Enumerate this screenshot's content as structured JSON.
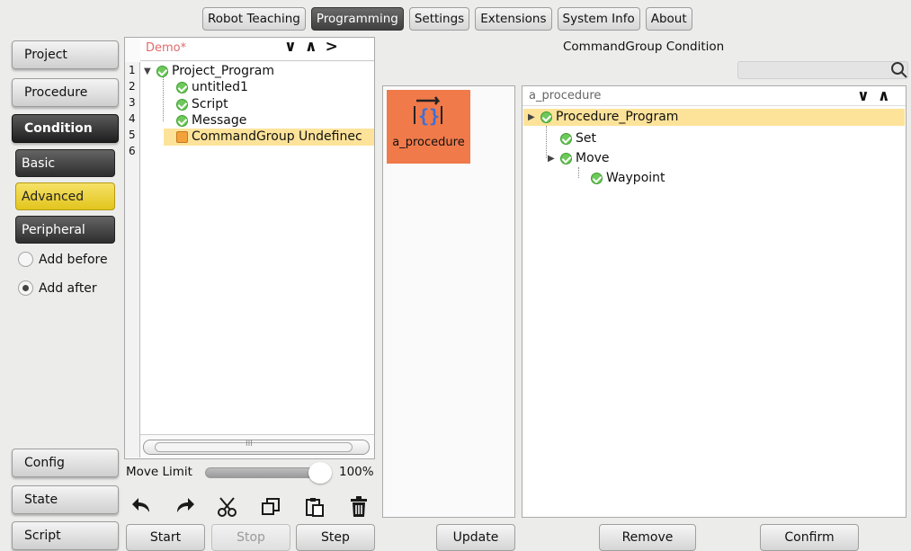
{
  "top_tabs": [
    {
      "label": "Robot Teaching",
      "active": false
    },
    {
      "label": "Programming",
      "active": true
    },
    {
      "label": "Settings",
      "active": false
    },
    {
      "label": "Extensions",
      "active": false
    },
    {
      "label": "System Info",
      "active": false
    },
    {
      "label": "About",
      "active": false
    }
  ],
  "left_nav": {
    "project": "Project",
    "procedure": "Procedure",
    "condition": "Condition",
    "basic": "Basic",
    "advanced": "Advanced",
    "peripheral": "Peripheral",
    "add_before": "Add before",
    "add_after": "Add after",
    "config": "Config",
    "state": "State",
    "script": "Script"
  },
  "program_tree": {
    "name": "Demo*",
    "nav_down": "∨",
    "nav_up": "∧",
    "nav_next": ">",
    "line_numbers": [
      "1",
      "2",
      "3",
      "4",
      "5",
      "6"
    ],
    "rows": [
      {
        "label": "Project_Program",
        "status": "ok"
      },
      {
        "label": "untitled1",
        "status": "ok"
      },
      {
        "label": "Script",
        "status": "ok"
      },
      {
        "label": "Message",
        "status": "ok"
      },
      {
        "label": "CommandGroup Undefinec",
        "status": "warn"
      }
    ],
    "scroll_grip": "III"
  },
  "move_limit": {
    "label": "Move Limit",
    "value_text": "100%",
    "value": 1.0
  },
  "toolbar_icons": [
    "undo-icon",
    "redo-icon",
    "cut-icon",
    "copy-icon",
    "paste-icon",
    "delete-icon"
  ],
  "bottom_buttons": {
    "start": "Start",
    "stop": "Stop",
    "step": "Step",
    "update": "Update",
    "remove": "Remove",
    "confirm": "Confirm"
  },
  "procedure_tile": {
    "label": "a_procedure"
  },
  "right": {
    "title": "CommandGroup Condition",
    "search_placeholder": "",
    "panel_name": "a_procedure",
    "nav_down": "∨",
    "nav_up": "∧",
    "rows": [
      {
        "label": "Procedure_Program"
      },
      {
        "label": "Set"
      },
      {
        "label": "Move"
      },
      {
        "label": "Waypoint"
      }
    ]
  }
}
